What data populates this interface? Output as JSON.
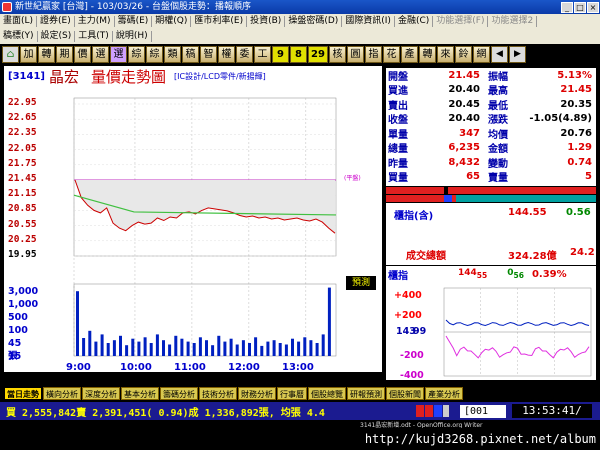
{
  "window": {
    "title": "新世紀贏家 [台灣] - 103/03/26 - 台盤個股走勢：播報順序"
  },
  "menu": {
    "row1": [
      "畫面(L)",
      "證券(E)",
      "主力(M)",
      "籌碼(E)",
      "期權(Q)",
      "匯市利率(E)",
      "投資(B)",
      "操盤密碼(D)",
      "國際資訊(I)",
      "金融(C)",
      "功能選擇(F)",
      "功能選擇2"
    ],
    "row2": [
      "稿標(Y)",
      "設定(S)",
      "工具(T)",
      "說明(H)"
    ]
  },
  "toolbar": {
    "buttons": [
      "加",
      "轉",
      "期",
      "價",
      "選",
      "選",
      "綜",
      "綜",
      "類",
      "稿",
      "智",
      "權",
      "委",
      "工",
      "9",
      "8",
      "29",
      "核",
      "圓",
      "指",
      "花",
      "產",
      "轉",
      "來",
      "鈴",
      "網"
    ]
  },
  "chart": {
    "code": "[3141]",
    "name": "晶宏",
    "title": "量價走勢圖",
    "category": "[IC設計/LCD零件/新揚輝]",
    "predict_label": "預測",
    "volume_unit": "張",
    "ref_label": "(平盤)"
  },
  "chart_data": {
    "type": "line",
    "x_labels": [
      "9:00",
      "10:00",
      "11:00",
      "12:00",
      "13:00"
    ],
    "y_ticks": [
      "22.95",
      "22.65",
      "22.35",
      "22.05",
      "21.75",
      "21.45",
      "21.15",
      "20.85",
      "20.55",
      "20.25",
      "19.95"
    ],
    "volume_ticks": [
      "3,000",
      "1,000",
      "500",
      "100",
      "45",
      "15"
    ],
    "ylim": [
      19.95,
      22.95
    ],
    "reference_price": 21.45,
    "avg_start": 21.15,
    "avg_end": 20.76,
    "open": 21.45,
    "high": 21.45,
    "low": 20.35,
    "last": 20.4,
    "price": [
      21.45,
      21.1,
      20.95,
      20.85,
      20.8,
      20.9,
      20.6,
      20.5,
      20.45,
      20.55,
      20.62,
      20.58,
      20.6,
      20.7,
      20.65,
      20.72,
      20.7,
      20.8,
      20.82,
      20.78,
      20.85,
      20.9,
      20.88,
      20.86,
      20.84,
      20.8,
      20.75,
      20.72,
      20.74,
      20.7,
      20.72,
      20.68,
      20.7,
      20.66,
      20.68,
      20.7,
      20.66,
      20.64,
      20.68,
      20.62,
      20.5,
      20.4
    ],
    "volume": [
      90,
      25,
      35,
      20,
      30,
      18,
      22,
      28,
      15,
      24,
      20,
      26,
      18,
      30,
      22,
      16,
      28,
      24,
      20,
      18,
      26,
      22,
      15,
      28,
      20,
      24,
      16,
      22,
      18,
      26,
      14,
      20,
      22,
      18,
      16,
      24,
      20,
      26,
      22,
      18,
      30,
      95
    ]
  },
  "quote": {
    "open_label": "開盤",
    "open": "21.45",
    "amp_label": "振幅",
    "amp": "5.13%",
    "bid_label": "買進",
    "bid": "20.40",
    "high_label": "最高",
    "high": "21.45",
    "ask_label": "賣出",
    "ask": "20.45",
    "low_label": "最低",
    "low": "20.35",
    "close_label": "收盤",
    "close": "20.40",
    "chg_label": "漲跌",
    "chg": "-1.05(4.89)",
    "lot_label": "單量",
    "lot": "347",
    "avg_label": "均價",
    "avg": "20.76",
    "vol_label": "總量",
    "vol": "6,235",
    "amt_label": "金額",
    "amt": "1.29",
    "yvol_label": "昨量",
    "yvol": "8,432",
    "turn_label": "變動",
    "turn": "0.74",
    "bq_label": "買量",
    "bq": "65",
    "sq_label": "賣量",
    "sq": "5"
  },
  "index": {
    "label": "櫃指(含)",
    "value": "144.55",
    "change": "0.56",
    "turnover_label": "成交總額",
    "turnover": "324.28億",
    "turnover_change": "24.2"
  },
  "otc": {
    "label": "櫃指",
    "value": "144",
    "value_sub": "55",
    "change": "0",
    "change_sub": "56",
    "pct": "0.39%",
    "ticks": [
      "+400",
      "+200",
      "143",
      "99",
      "-200",
      "-400"
    ]
  },
  "tabs": [
    "當日走勢",
    "橫向分析",
    "深度分析",
    "基本分析",
    "籌碼分析",
    "技術分析",
    "財務分析",
    "行事曆",
    "個股總覽",
    "研報預測",
    "個股新聞",
    "產業分析"
  ],
  "status": {
    "stats": "買 2,555,842賣 2,391,451( 0.94)成 1,336,892張, 均張 4.4",
    "code": "[001",
    "clock": "13:53:41/"
  },
  "fileinfo": "3141晶宏新增.odt - OpenOffice.org Writer",
  "footer": "http://kujd3268.pixnet.net/album"
}
